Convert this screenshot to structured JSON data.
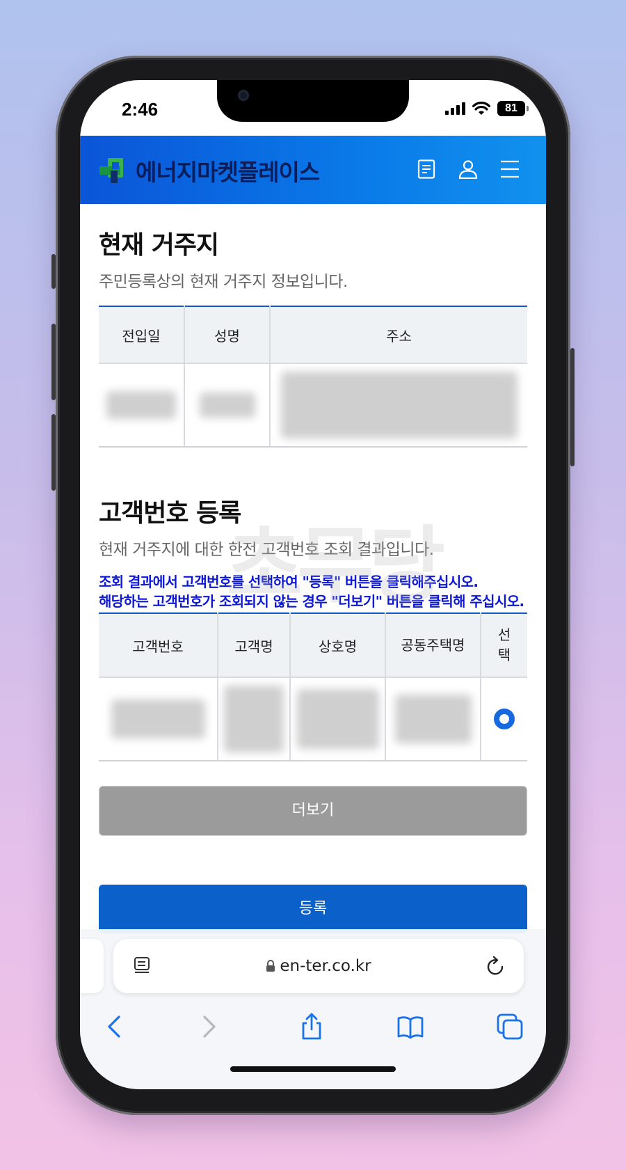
{
  "status_bar": {
    "time": "2:46",
    "battery": "81"
  },
  "app": {
    "logo_text": "에너지마켓플레이스"
  },
  "residence": {
    "title": "현재 거주지",
    "subtitle": "주민등록상의 현재 거주지 정보입니다.",
    "columns": [
      "전입일",
      "성명",
      "주소"
    ]
  },
  "customer": {
    "title": "고객번호 등록",
    "subtitle": "현재 거주지에 대한 한전 고객번호 조회 결과입니다.",
    "notice_line1": "조회 결과에서 고객번호를 선택하여 \"등록\" 버튼을 클릭해주십시오.",
    "notice_line2": "해당하는 고객번호가 조회되지 않는 경우 \"더보기\" 버튼을 클릭해 주십시오.",
    "columns": [
      "고객번호",
      "고객명",
      "상호명",
      "공동주택명",
      "선택"
    ]
  },
  "buttons": {
    "more": "더보기",
    "register": "등록"
  },
  "browser": {
    "url": "en-ter.co.kr"
  },
  "watermark": "초무당",
  "colors": {
    "brand": "#0b55d8",
    "notice": "#0d18d6",
    "register_button": "#0b60c9"
  },
  "icons": [
    "document-icon",
    "user-icon",
    "menu-icon",
    "lock-icon",
    "reader-icon",
    "reload-icon",
    "back-icon",
    "forward-icon",
    "share-icon",
    "bookmarks-icon",
    "tabs-icon"
  ]
}
